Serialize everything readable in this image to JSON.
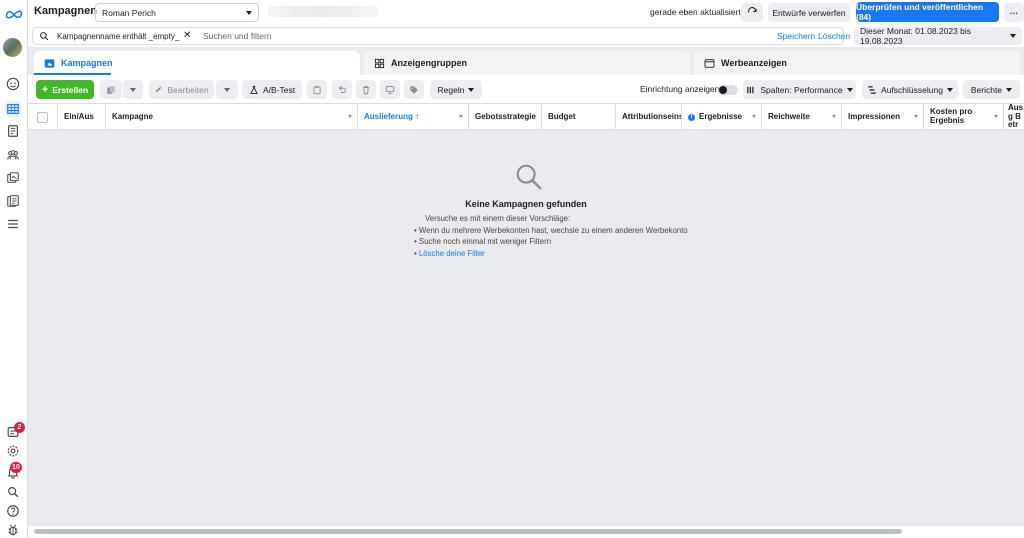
{
  "app": {
    "title": "Kampagnen",
    "account": "Roman Perich"
  },
  "topbar": {
    "updated": "gerade eben aktualisiert",
    "discard_label": "Entwürfe verwerfen",
    "publish_label": "Überprüfen und veröffentlichen (84)",
    "more_label": "···"
  },
  "search": {
    "filter_chip": "Kampagnenname enthält _empty_",
    "placeholder": "Suchen und filtern",
    "save_label": "Speichern",
    "clear_label": "Löschen",
    "date_range": "Dieser Monat: 01.08.2023 bis 19.08.2023"
  },
  "tabs": [
    {
      "label": "Kampagnen",
      "active": true
    },
    {
      "label": "Anzeigengruppen",
      "active": false
    },
    {
      "label": "Werbeanzeigen",
      "active": false
    }
  ],
  "toolbar": {
    "create_label": "Erstellen",
    "edit_label": "Bearbeiten",
    "ab_test_label": "A/B-Test",
    "rules_label": "Regeln",
    "setup_label": "Einrichtung anzeigen",
    "columns_label": "Spalten: Performance",
    "breakdown_label": "Aufschlüsselung",
    "reports_label": "Berichte"
  },
  "table": {
    "columns": [
      "Ein/Aus",
      "Kampagne",
      "Auslieferung ↑",
      "Gebotsstrategie",
      "Budget",
      "Attributionseinst",
      "Ergebnisse",
      "Reichweite",
      "Impressionen",
      "Kosten pro Ergebnis",
      "Ausg Betr"
    ]
  },
  "empty_state": {
    "title": "Keine Kampagnen gefunden",
    "intro": "Versuche es mit einem dieser Vorschläge:",
    "suggestions": [
      "Wenn du mehrere Werbekonten hast, wechsle zu einem anderen Werbekonto",
      "Suche noch einmal mit weniger Filtern"
    ],
    "link": "Lösche deine Filter"
  },
  "rail": {
    "badges": [
      "2",
      "10"
    ]
  },
  "colors": {
    "primary": "#1877f2",
    "create": "#42b72a",
    "badge": "#e41e3f",
    "background": "#e9eaed"
  }
}
